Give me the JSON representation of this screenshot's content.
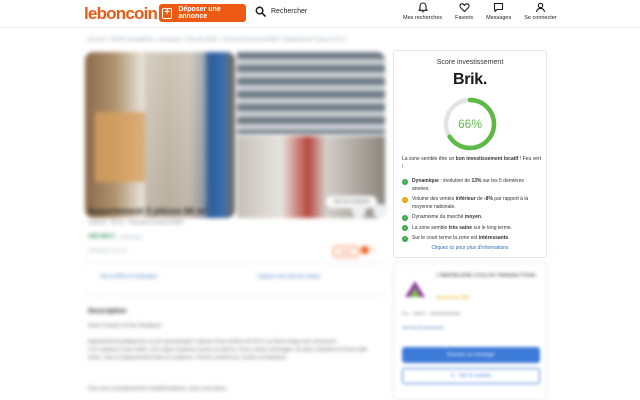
{
  "header": {
    "logo": "leboncoin",
    "post_button": "Déposer une annonce",
    "search_label": "Rechercher",
    "nav": [
      {
        "icon": "bell-icon",
        "label": "Mes recherches"
      },
      {
        "icon": "heart-icon",
        "label": "Favoris"
      },
      {
        "icon": "message-icon",
        "label": "Messages"
      },
      {
        "icon": "user-icon",
        "label": "Se connecter"
      }
    ]
  },
  "listing": {
    "breadcrumb": "Accueil  >  Ventes immobilières  >  Auvergne  >  Puy-de-Dôme  >  Clermont-Ferrand 63000  >  Appartement 3 pièces 66 m²",
    "photo_count": "Voir les 8 photos",
    "title": "Appartement 3 pièces 66 m²",
    "subtitle": "3 pièces · 66 m² · Clermont-Ferrand 63000",
    "price": "156 000 €",
    "price_note": "2 364 €/m²",
    "date": "28/09/2023 à 16:07",
    "tag": "Urgent",
    "tag_count": "1",
    "link_left": "Voir le DPE et l'estimation",
    "link_right": "Estimer mes frais de notaire",
    "description_title": "Description",
    "description_lines": [
      "Entre Fontaine et Parc Montjuzet.",
      "Appartement privilégié par sa vue panoramique 3 pièces d'une surface de 66 m² au 5ème étage avec ascenseur.",
      "Il se compose d'une entrée, d'un séjour lumineux ouvert sur balcon, d'une cuisine aménagée, de deux chambres et d'une salle",
      "d'eau. Cave et stationnement dans la résidence. Proche commerces, écoles et transports.",
      "",
      "Pour tous renseignements complémentaires, nous vous prions."
    ]
  },
  "brik": {
    "heading": "Score investissement",
    "logo": "Brik.",
    "score": 66,
    "score_label": "66%",
    "score_color": "#5dbb45",
    "intro_prefix": "La zone semble être un ",
    "intro_bold": "bon investissement locatif",
    "intro_suffix": " ! Feu vert !",
    "items": [
      {
        "status": "ok",
        "pre": "",
        "bold": "Dynamique",
        "post": " : évolution de ",
        "bold2": "13%",
        "post2": " sur les 5 dernières années."
      },
      {
        "status": "warn",
        "pre": "Volume des ventes ",
        "bold": "inférieur",
        "post": " de ",
        "bold2": "-8%",
        "post2": " par rapport à la moyenne nationale."
      },
      {
        "status": "ok",
        "pre": "Dynamisme du marché ",
        "bold": "moyen",
        "post": ".",
        "bold2": "",
        "post2": ""
      },
      {
        "status": "ok",
        "pre": "La zone semble ",
        "bold": "très saine",
        "post": " sur le long terme.",
        "bold2": "",
        "post2": ""
      },
      {
        "status": "ok",
        "pre": "Sur le court terme la zone est ",
        "bold": "intéressante",
        "post": ".",
        "bold2": "",
        "post2": ""
      }
    ],
    "link": "Cliquez ici pour plus d'informations"
  },
  "seller": {
    "name": "L'IMMOBILIÈRE COULON TRANSACTIONS",
    "stars": "★★★★★ (26)",
    "meta": "Pro · SIRET · 000000000000",
    "more": "Voir les 42 annonces",
    "message_button": "Envoyer un message",
    "call_button": "Voir le numéro"
  }
}
